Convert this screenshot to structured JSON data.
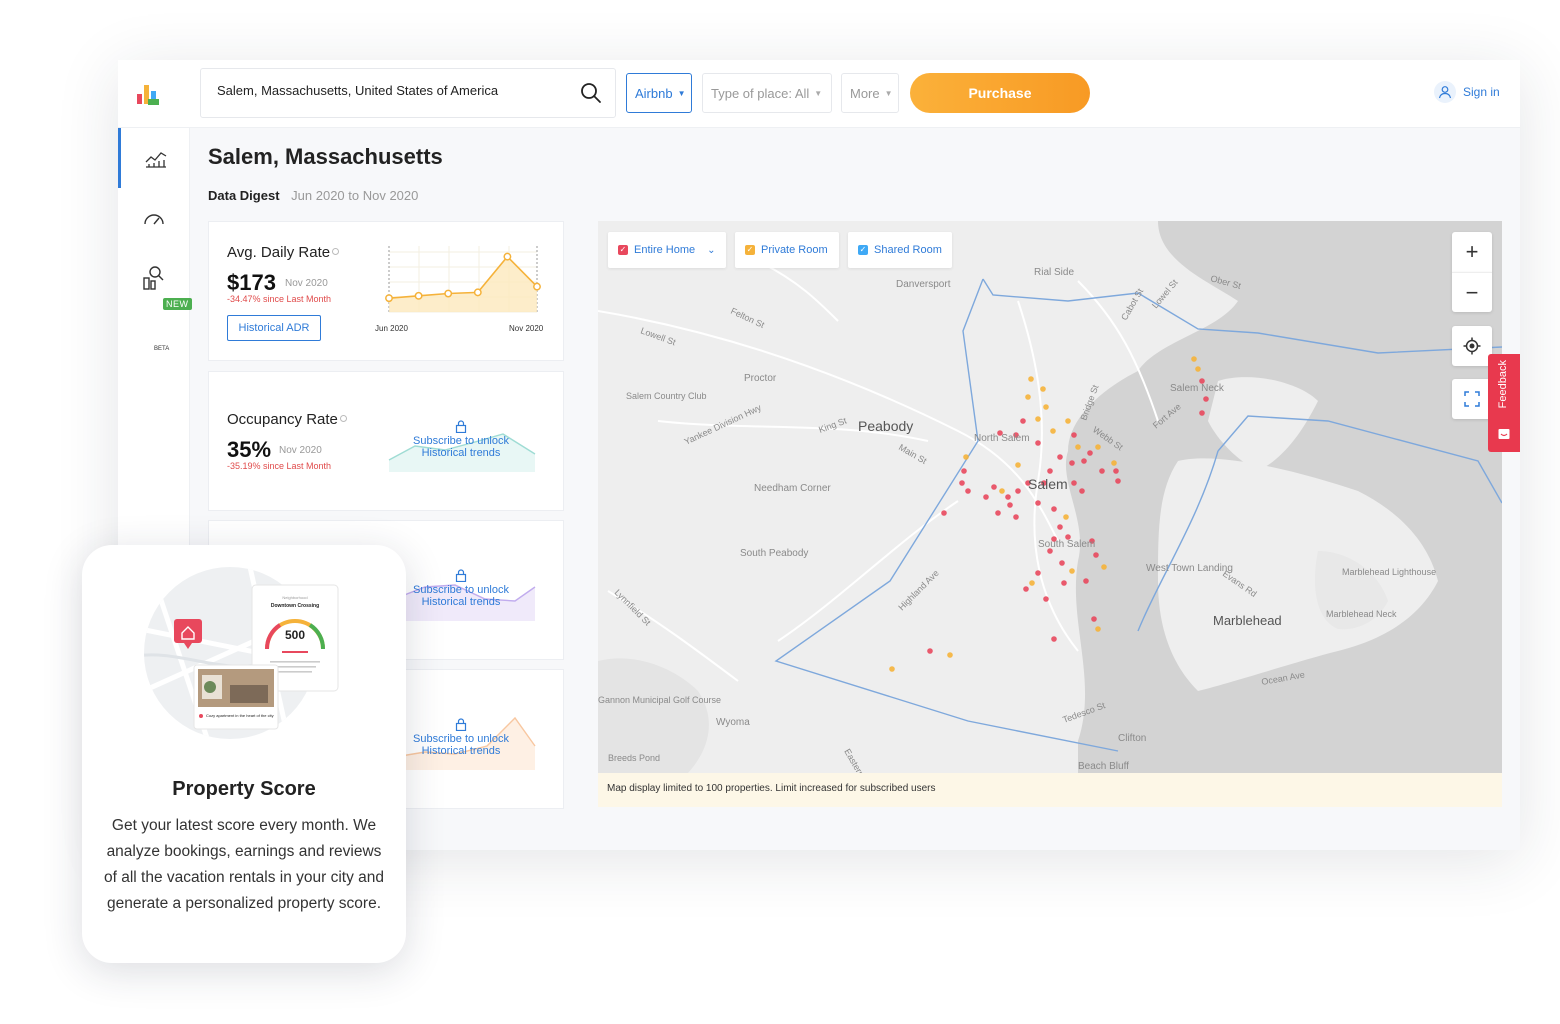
{
  "header": {
    "search_value": "Salem, Massachusetts, United States of America",
    "source_label": "Airbnb",
    "type_label": "Type of place: All",
    "more_label": "More",
    "purchase_label": "Purchase",
    "signin_label": "Sign in"
  },
  "sidebar": {
    "beta_label": "BETA",
    "new_label": "NEW",
    "items": [
      {
        "icon": "market-chart-icon"
      },
      {
        "icon": "gauge-icon"
      },
      {
        "icon": "property-search-icon"
      }
    ]
  },
  "page": {
    "title": "Salem, Massachusetts",
    "digest_label": "Data Digest",
    "digest_range": "Jun 2020 to Nov 2020"
  },
  "cards": {
    "adr": {
      "name": "Avg. Daily Rate",
      "value": "$173",
      "date": "Nov 2020",
      "delta": "-34.47% since Last Month",
      "button": "Historical ADR",
      "chart_start": "Jun 2020",
      "chart_end": "Nov 2020",
      "trend": [
        12,
        14,
        16,
        17,
        48,
        22
      ]
    },
    "occupancy": {
      "name": "Occupancy Rate",
      "value": "35%",
      "date": "Nov 2020",
      "delta": "-35.19% since Last Month"
    },
    "unlock_line1": "Subscribe to unlock",
    "unlock_line2": "Historical trends"
  },
  "map": {
    "filters": [
      {
        "label": "Entire Home",
        "color": "#e8485d"
      },
      {
        "label": "Private Room",
        "color": "#f5b23a"
      },
      {
        "label": "Shared Room",
        "color": "#3fa9f5"
      }
    ],
    "zoom_in": "+",
    "zoom_out": "−",
    "places": [
      {
        "name": "Peabody"
      },
      {
        "name": "Salem"
      },
      {
        "name": "Marblehead"
      },
      {
        "name": "North Salem"
      },
      {
        "name": "South Salem"
      },
      {
        "name": "Salem Neck"
      },
      {
        "name": "Danversport"
      },
      {
        "name": "Rial Side"
      },
      {
        "name": "Proctor"
      },
      {
        "name": "Salem Country Club"
      },
      {
        "name": "Needham Corner"
      },
      {
        "name": "South Peabody"
      },
      {
        "name": "West Town Landing"
      },
      {
        "name": "Marblehead Lighthouse"
      },
      {
        "name": "Marblehead Neck"
      },
      {
        "name": "Gannon Municipal Golf Course"
      },
      {
        "name": "Wyoma"
      },
      {
        "name": "Clifton"
      },
      {
        "name": "Beach Bluff"
      },
      {
        "name": "Breeds Pond"
      },
      {
        "name": "Lowell St"
      },
      {
        "name": "Felton St"
      },
      {
        "name": "King St"
      },
      {
        "name": "Main St"
      },
      {
        "name": "Yankee Division Hwy"
      },
      {
        "name": "Highland Ave"
      },
      {
        "name": "Lynnfield St"
      },
      {
        "name": "Bridge St"
      },
      {
        "name": "Webb St"
      },
      {
        "name": "Fort Ave"
      },
      {
        "name": "Cabot St"
      },
      {
        "name": "Lowel St"
      },
      {
        "name": "Ober St"
      },
      {
        "name": "Evans Rd"
      },
      {
        "name": "Ocean Ave"
      },
      {
        "name": "Tedesco St"
      },
      {
        "name": "Eastern"
      }
    ],
    "footer_note": "Map display limited to 100 properties. Limit increased for subscribed users"
  },
  "feedback_label": "Feedback",
  "promo": {
    "title": "Property Score",
    "text": "Get your latest score every month. We analyze bookings, earnings and reviews of all the vacation rentals in your city and generate a personalized property score.",
    "illustration": {
      "card_eyebrow": "Neighborhood",
      "card_title": "Downtown Crossing",
      "score": "500",
      "listing_caption": "Cozy apartment in the heart of the city"
    }
  }
}
